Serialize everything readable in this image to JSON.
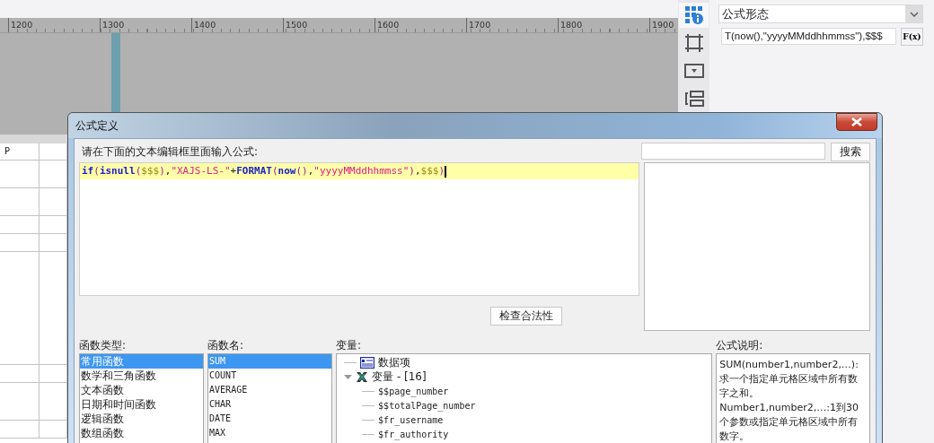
{
  "ruler": {
    "labels": [
      "1200",
      "1300",
      "1400",
      "1500",
      "1600",
      "1700",
      "1800",
      "1900"
    ]
  },
  "sheet": {
    "column_header": "P"
  },
  "side_tabs": [
    {
      "selected": true
    },
    {
      "selected": false
    },
    {
      "selected": false
    },
    {
      "selected": false
    }
  ],
  "properties": {
    "mode": "公式形态",
    "formula_value": "T(now(),\"yyyyMMddhhmmss\"),$$$",
    "fx_label": "F(x)"
  },
  "dialog": {
    "title": "公式定义",
    "prompt": "请在下面的文本编辑框里面输入公式:",
    "search_button": "搜索",
    "formula_tokens": [
      {
        "kind": "function",
        "text": "if"
      },
      {
        "kind": "paren",
        "text": "("
      },
      {
        "kind": "function",
        "text": "isnull"
      },
      {
        "kind": "paren",
        "text": "("
      },
      {
        "kind": "variable",
        "text": "$$$"
      },
      {
        "kind": "paren",
        "text": ")"
      },
      {
        "kind": "plain",
        "text": ","
      },
      {
        "kind": "string",
        "text": "\"XAJS-LS-\""
      },
      {
        "kind": "plain",
        "text": "+"
      },
      {
        "kind": "function",
        "text": "FORMAT"
      },
      {
        "kind": "paren",
        "text": "("
      },
      {
        "kind": "function",
        "text": "now"
      },
      {
        "kind": "paren",
        "text": "()"
      },
      {
        "kind": "plain",
        "text": ","
      },
      {
        "kind": "string",
        "text": "\"yyyyMMddhhmmss\""
      },
      {
        "kind": "paren",
        "text": ")"
      },
      {
        "kind": "plain",
        "text": ","
      },
      {
        "kind": "variable",
        "text": "$$$"
      },
      {
        "kind": "paren",
        "text": ")"
      }
    ],
    "check_button": "检查合法性",
    "type_label": "函数类型:",
    "types": [
      {
        "label": "常用函数",
        "selected": true
      },
      {
        "label": "数学和三角函数",
        "selected": false
      },
      {
        "label": "文本函数",
        "selected": false
      },
      {
        "label": "日期和时间函数",
        "selected": false
      },
      {
        "label": "逻辑函数",
        "selected": false
      },
      {
        "label": "数组函数",
        "selected": false
      }
    ],
    "name_label": "函数名:",
    "names": [
      {
        "label": "SUM",
        "selected": true
      },
      {
        "label": "COUNT",
        "selected": false
      },
      {
        "label": "AVERAGE",
        "selected": false
      },
      {
        "label": "CHAR",
        "selected": false
      },
      {
        "label": "DATE",
        "selected": false
      },
      {
        "label": "MAX",
        "selected": false
      }
    ],
    "var_label": "变量:",
    "variables": [
      {
        "label": "数据项",
        "kind": "data"
      },
      {
        "label": "变量 - [16]",
        "kind": "group",
        "expanded": true,
        "children": [
          {
            "label": "$$page_number"
          },
          {
            "label": "$$totalPage_number"
          },
          {
            "label": "$fr_username"
          },
          {
            "label": "$fr_authority"
          }
        ]
      }
    ],
    "desc_label": "公式说明:",
    "description": [
      "SUM(number1,number2,…): 求一个指定单元格区域中所有数字之和。",
      "Number1,number2,…:1到30个参数或指定单元格区域中所有数字。"
    ]
  }
}
